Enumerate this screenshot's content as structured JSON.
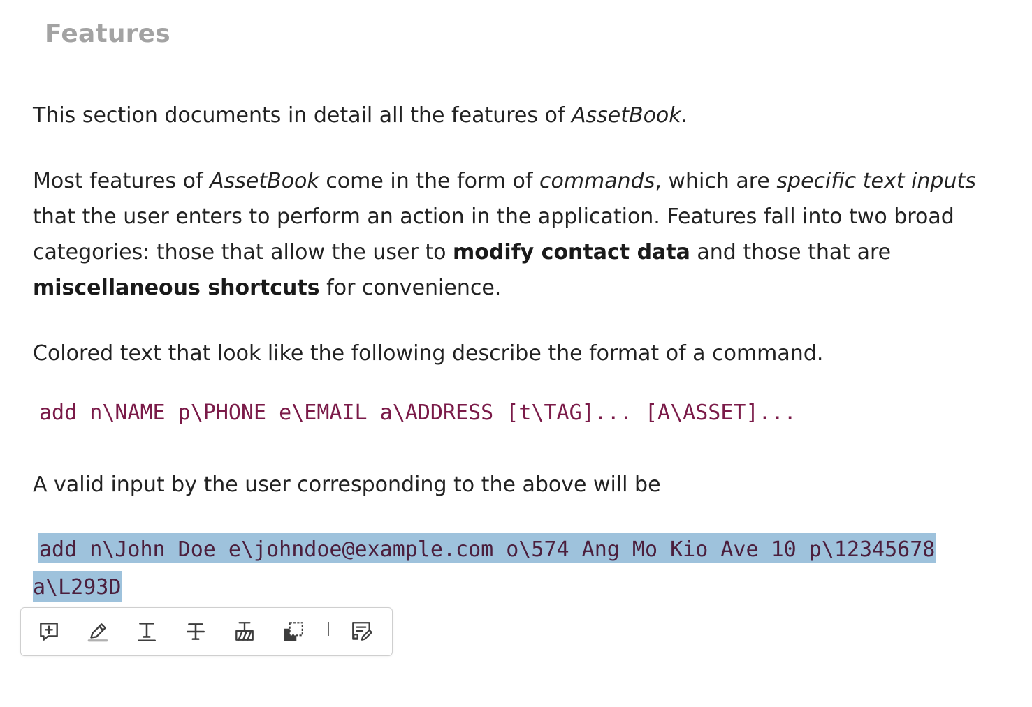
{
  "heading": "Features",
  "intro": {
    "before": "This section documents in detail all the features of ",
    "app": "AssetBook",
    "after": "."
  },
  "features_para": {
    "t1": "Most features of ",
    "app": "AssetBook",
    "t2": " come in the form of ",
    "commands": "commands",
    "t3": ", which are ",
    "specific": "specific text inputs",
    "t4": " that the user enters to perform an action in the application. Features fall into two broad categories: those that allow the user to ",
    "modify": "modify contact data",
    "t5": " and those that are ",
    "misc": "miscellaneous shortcuts",
    "t6": " for convenience."
  },
  "format_para": "Colored text that look like the following describe the format of a command.",
  "format_code": "add n\\NAME p\\PHONE e\\EMAIL a\\ADDRESS [t\\TAG]... [A\\ASSET]...",
  "example_para": "A valid input by the user corresponding to the above will be",
  "example_code": {
    "line1": "add n\\John Doe e\\johndoe@example.com o\\574 Ang Mo Kio Ave 10 p\\12345678",
    "line2": "a\\L293D"
  },
  "toolbar": {
    "icons": [
      "add-comment-icon",
      "highlight-icon",
      "underline-icon",
      "strikethrough-icon",
      "replace-text-icon",
      "copy-area-icon",
      "edit-notes-icon"
    ],
    "icon_color": "#3d3d3d"
  },
  "colors": {
    "heading": "#a3a3a3",
    "code": "#7a1a48",
    "selection": "#9ec2dc"
  }
}
